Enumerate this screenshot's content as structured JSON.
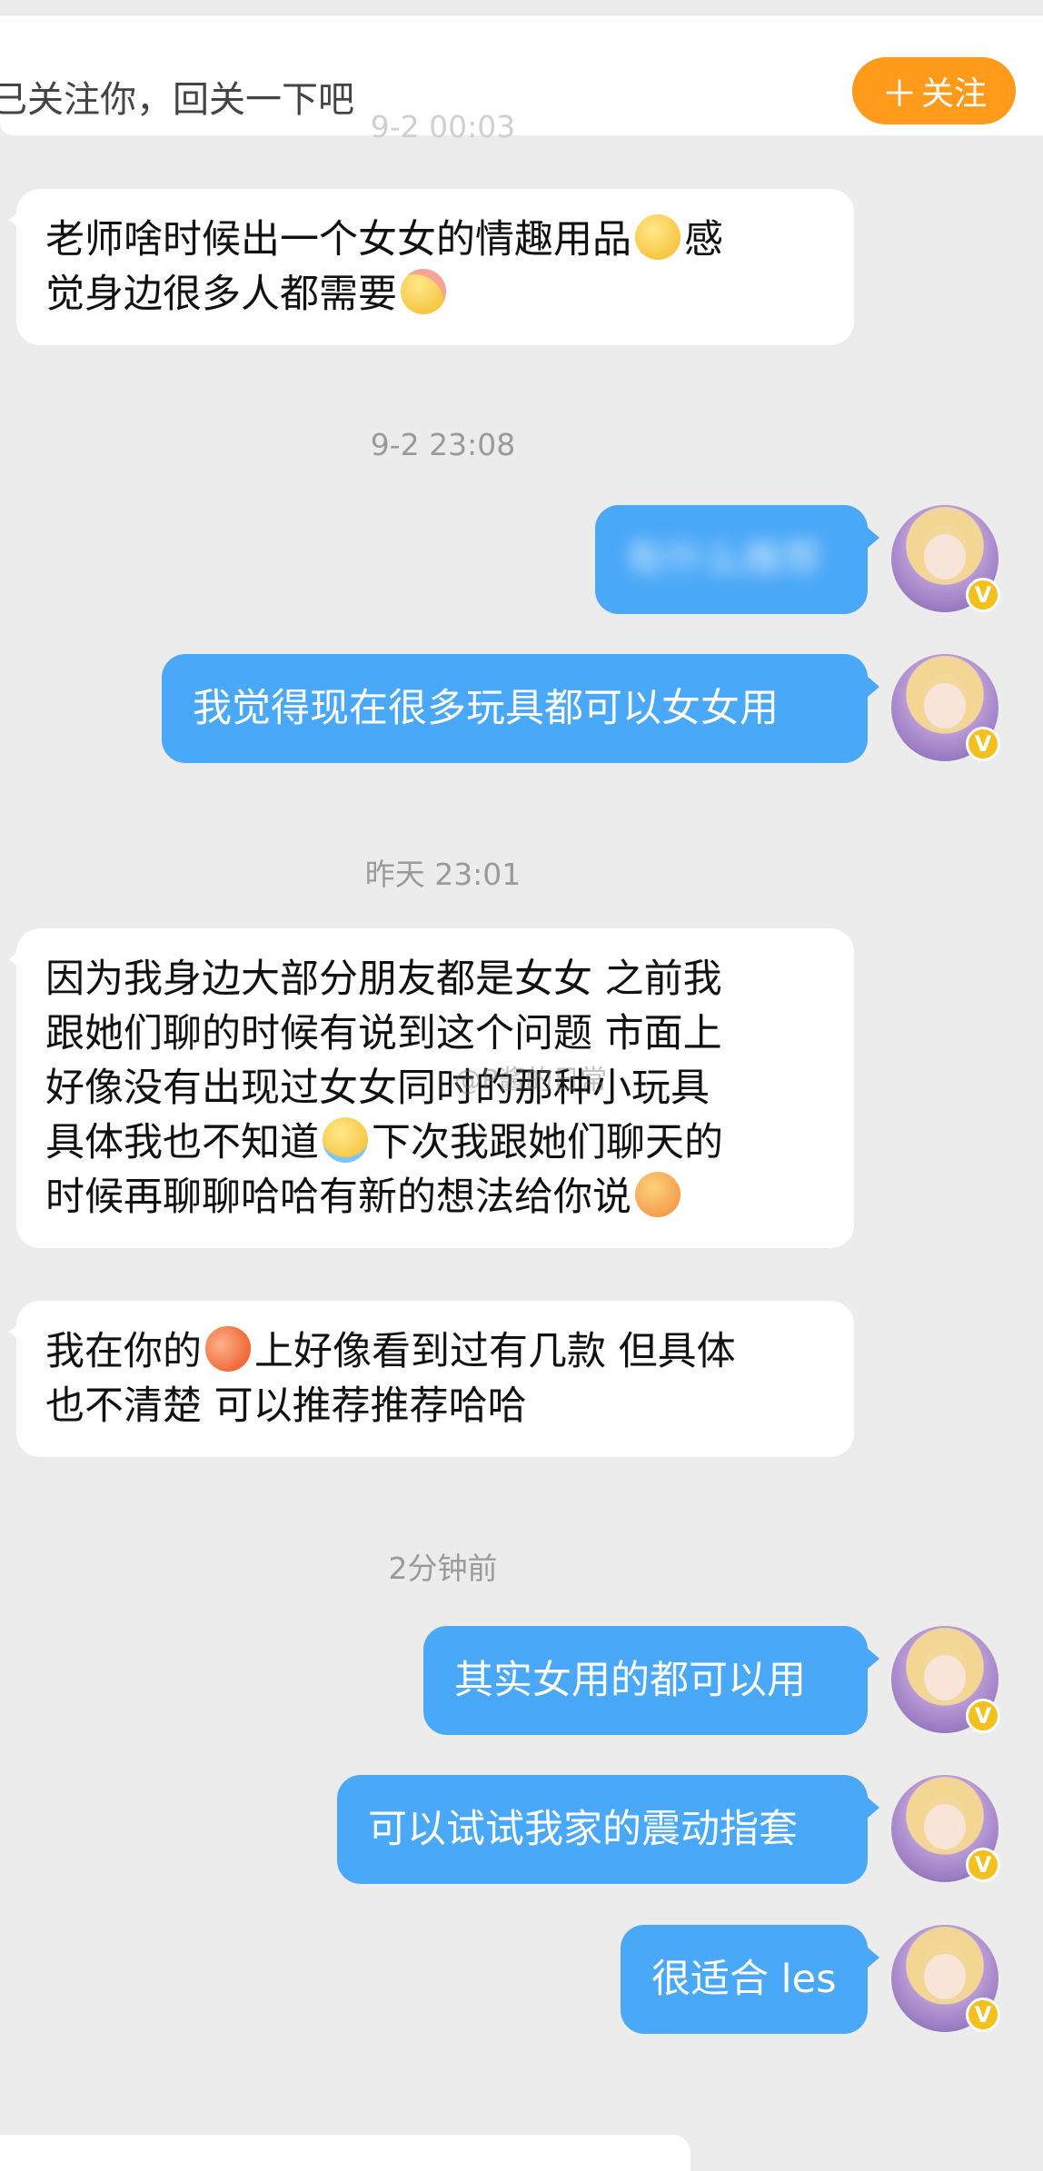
{
  "header": {
    "notice": "已关注你，回关一下吧",
    "follow_label": "关注",
    "follow_icon": "plus-icon"
  },
  "timestamps": [
    "9-2 00:03",
    "9-2 23:08",
    "昨天 23:01",
    "2分钟前"
  ],
  "messages": {
    "m1": {
      "line1": "老师啥时候出一个女女的情趣用品",
      "line1b": "感",
      "line2": "觉身边很多人都需要"
    },
    "m2": {
      "text": "有什么推荐"
    },
    "m3": {
      "text": "我觉得现在很多玩具都可以女女用"
    },
    "m4": {
      "line1": "因为我身边大部分朋友都是女女 之前我",
      "line2": "跟她们聊的时候有说到这个问题 市面上",
      "line3": "好像没有出现过女女同时的那种小玩具",
      "line4a": "具体我也不知道",
      "line4b": "下次我跟她们聊天的",
      "line5": "时候再聊聊哈哈有新的想法给你说"
    },
    "m5": {
      "line1a": "我在你的",
      "line1b": "上好像看到过有几款 但具体",
      "line2": "也不清楚 可以推荐推荐哈哈"
    },
    "m6": {
      "text": "其实女用的都可以用"
    },
    "m7": {
      "text": "可以试试我家的震动指套"
    },
    "m8": {
      "text": "很适合 les"
    }
  },
  "watermark": "@P酱的日常",
  "verified_badge": "V",
  "colors": {
    "outgoing": "#4aa8f8",
    "follow": "#ff9a1a",
    "background": "#ececec"
  }
}
